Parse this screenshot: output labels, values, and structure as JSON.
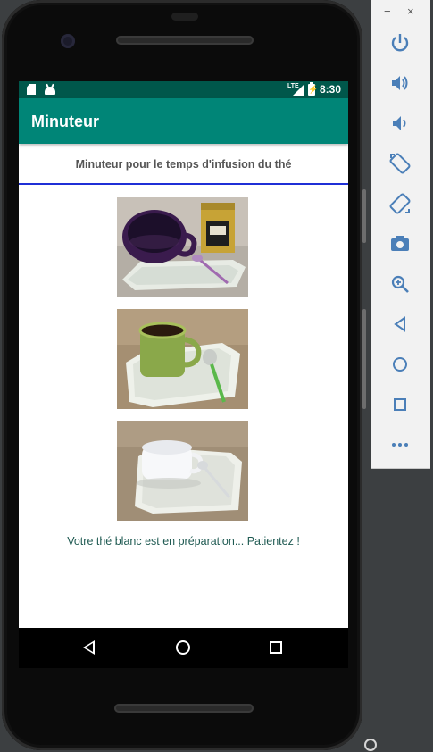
{
  "app": {
    "title": "Minuteur",
    "subtitle": "Minuteur pour le temps d'infusion du thé",
    "status_message": "Votre thé blanc est en préparation... Patientez !"
  },
  "status_bar": {
    "time": "8:30",
    "network": "LTE",
    "icons": [
      "sd-card-icon",
      "android-icon",
      "signal-icon",
      "battery-icon"
    ]
  },
  "images": [
    {
      "name": "tea-cup-purple-image",
      "description_icon": "purple-mug-with-tea-tin"
    },
    {
      "name": "tea-cup-green-image",
      "description_icon": "green-mug-with-spoon"
    },
    {
      "name": "tea-cup-white-image",
      "description_icon": "white-cup-on-saucer"
    }
  ],
  "nav_bar": {
    "buttons": [
      "back-icon",
      "home-icon",
      "recents-icon"
    ]
  },
  "emulator_toolbar": {
    "window_controls": [
      "−",
      "×"
    ],
    "buttons": [
      "power-icon",
      "volume-up-icon",
      "volume-down-icon",
      "rotate-left-icon",
      "rotate-right-icon",
      "camera-icon",
      "zoom-icon",
      "back-icon",
      "home-icon",
      "overview-icon",
      "more-icon"
    ]
  },
  "colors": {
    "primary": "#008577",
    "primary_dark": "#00574b",
    "divider": "#1f2fd6",
    "message_text": "#1f5a52"
  }
}
